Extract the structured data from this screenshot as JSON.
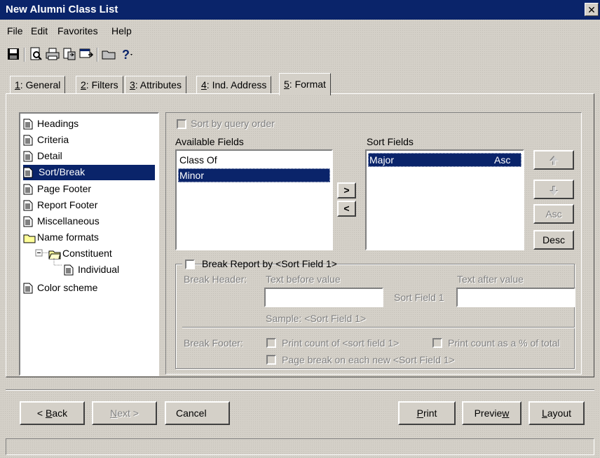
{
  "window": {
    "title": "New Alumni Class List"
  },
  "menu": [
    "File",
    "Edit",
    "Favorites",
    "Help"
  ],
  "toolbar_icons": [
    "save-icon",
    "print-preview-icon",
    "print-icon",
    "export-icon",
    "export-to-file-icon",
    "folder-icon",
    "help-icon"
  ],
  "tabs": [
    {
      "key": "1",
      "rest": ": General"
    },
    {
      "key": "2",
      "rest": ": Filters"
    },
    {
      "key": "3",
      "rest": ": Attributes"
    },
    {
      "key": "4",
      "rest": ": Ind. Address"
    },
    {
      "key": "5",
      "rest": ": Format"
    }
  ],
  "tree": {
    "items": [
      {
        "label": "Headings",
        "icon": "document-icon"
      },
      {
        "label": "Criteria",
        "icon": "document-icon"
      },
      {
        "label": "Detail",
        "icon": "document-icon"
      },
      {
        "label": "Sort/Break",
        "icon": "document-icon",
        "selected": true
      },
      {
        "label": "Page Footer",
        "icon": "document-icon"
      },
      {
        "label": "Report Footer",
        "icon": "document-icon"
      },
      {
        "label": "Miscellaneous",
        "icon": "document-icon"
      },
      {
        "label": "Name formats",
        "icon": "folder-icon"
      },
      {
        "label": "Constituent",
        "icon": "folder-open-icon"
      },
      {
        "label": "Individual",
        "icon": "document-icon"
      },
      {
        "label": "Color scheme",
        "icon": "document-icon"
      }
    ]
  },
  "sort": {
    "query_order_label": "Sort by query order",
    "available_label": "Available Fields",
    "available": [
      "Class Of",
      "Minor"
    ],
    "sort_fields_label": "Sort Fields",
    "sort_fields": [
      {
        "name": "Major",
        "order": "Asc"
      }
    ],
    "add_label": ">",
    "remove_label": "<",
    "asc_label": "Asc",
    "desc_label": "Desc"
  },
  "break": {
    "checkbox_label": "Break Report by <Sort Field 1>",
    "header_label": "Break Header:",
    "text_before_label": "Text before value",
    "text_after_label": "Text after value",
    "sort_field_label": "Sort Field 1",
    "sample_label": "Sample:  <Sort Field 1>",
    "footer_label": "Break Footer:",
    "print_count_label": "Print count of <sort field 1>",
    "print_pct_label": "Print count as a % of total",
    "page_break_label": "Page break on each new <Sort Field 1>"
  },
  "buttons": {
    "back_key": "B",
    "back_pre": "< ",
    "back_rest": "ack",
    "next_key": "N",
    "next_rest": "ext >",
    "cancel": "Cancel",
    "print_key": "P",
    "print_rest": "rint",
    "preview_pre": "Previe",
    "preview_key": "w",
    "layout_key": "L",
    "layout_rest": "ayout"
  },
  "colors": {
    "title_bar": "#0a246a",
    "face": "#d4d0c8",
    "selection": "#0a246a"
  }
}
